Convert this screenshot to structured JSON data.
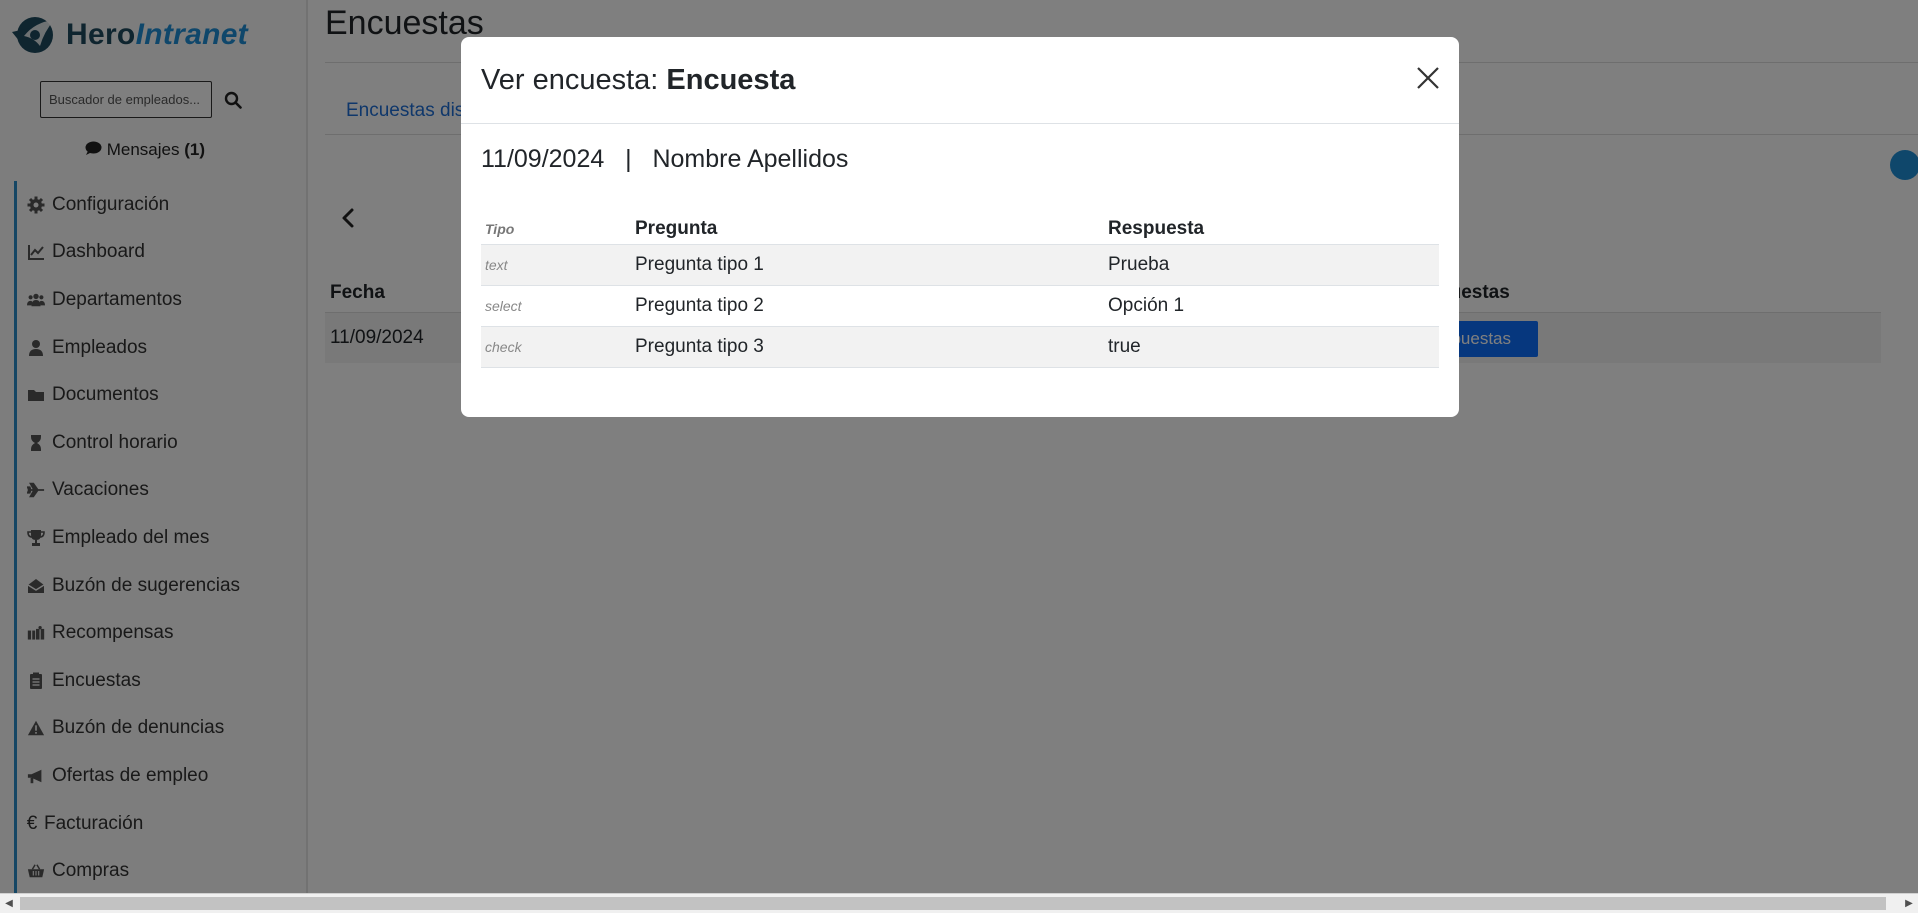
{
  "brand": {
    "name_part1": "Hero",
    "name_part2": "Intranet"
  },
  "search": {
    "placeholder": "Buscador de empleados..."
  },
  "messages": {
    "label": "Mensajes",
    "count": "(1)"
  },
  "sidebar": {
    "items": [
      {
        "label": "Configuración",
        "icon": "gear-icon"
      },
      {
        "label": "Dashboard",
        "icon": "chart-line-icon"
      },
      {
        "label": "Departamentos",
        "icon": "users-icon"
      },
      {
        "label": "Empleados",
        "icon": "user-icon"
      },
      {
        "label": "Documentos",
        "icon": "folder-icon"
      },
      {
        "label": "Control horario",
        "icon": "hourglass-icon"
      },
      {
        "label": "Vacaciones",
        "icon": "plane-icon"
      },
      {
        "label": "Empleado del mes",
        "icon": "trophy-icon"
      },
      {
        "label": "Buzón de sugerencias",
        "icon": "mail-box-icon"
      },
      {
        "label": "Recompensas",
        "icon": "gifts-icon"
      },
      {
        "label": "Encuestas",
        "icon": "clipboard-list-icon"
      },
      {
        "label": "Buzón de denuncias",
        "icon": "warning-icon"
      },
      {
        "label": "Ofertas de empleo",
        "icon": "megaphone-icon"
      },
      {
        "label": "Facturación",
        "icon": "euro-icon"
      },
      {
        "label": "Compras",
        "icon": "basket-icon"
      }
    ]
  },
  "page": {
    "title": "Encuestas",
    "tab_label": "Encuestas dis"
  },
  "background_table": {
    "col_fecha": "Fecha",
    "col_respuestas": "puestas",
    "row_fecha": "11/09/2024",
    "row_button": "spuestas"
  },
  "modal": {
    "title_prefix": "Ver encuesta: ",
    "title_name": "Encuesta",
    "date": "11/09/2024",
    "separator": "|",
    "person": "Nombre Apellidos",
    "headers": {
      "tipo": "Tipo",
      "pregunta": "Pregunta",
      "respuesta": "Respuesta"
    },
    "rows": [
      {
        "tipo": "text",
        "pregunta": "Pregunta tipo 1",
        "respuesta": "Prueba"
      },
      {
        "tipo": "select",
        "pregunta": "Pregunta tipo 2",
        "respuesta": "Opción 1"
      },
      {
        "tipo": "check",
        "pregunta": "Pregunta tipo 3",
        "respuesta": "true"
      }
    ]
  },
  "colors": {
    "accent": "#1f8fd6",
    "primary_button": "#0d6efd",
    "overlay": "rgba(0,0,0,0.5)"
  }
}
